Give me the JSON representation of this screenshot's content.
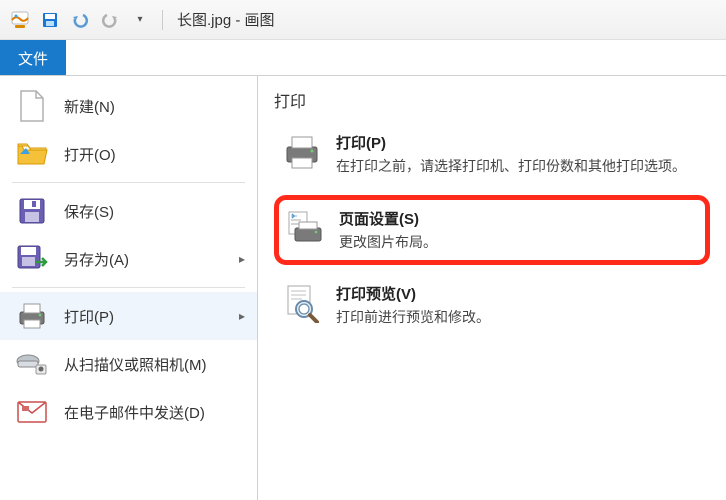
{
  "titlebar": {
    "filename": "长图.jpg",
    "appname": "画图",
    "separator": " - "
  },
  "tabs": {
    "file": "文件"
  },
  "menu": {
    "new": "新建(N)",
    "open": "打开(O)",
    "save": "保存(S)",
    "saveas": "另存为(A)",
    "print": "打印(P)",
    "scanner": "从扫描仪或照相机(M)",
    "email": "在电子邮件中发送(D)"
  },
  "panel": {
    "title": "打印",
    "print": {
      "title": "打印(P)",
      "desc": "在打印之前，请选择打印机、打印份数和其他打印选项。"
    },
    "pagesetup": {
      "title": "页面设置(S)",
      "desc": "更改图片布局。"
    },
    "preview": {
      "title": "打印预览(V)",
      "desc": "打印前进行预览和修改。"
    }
  }
}
